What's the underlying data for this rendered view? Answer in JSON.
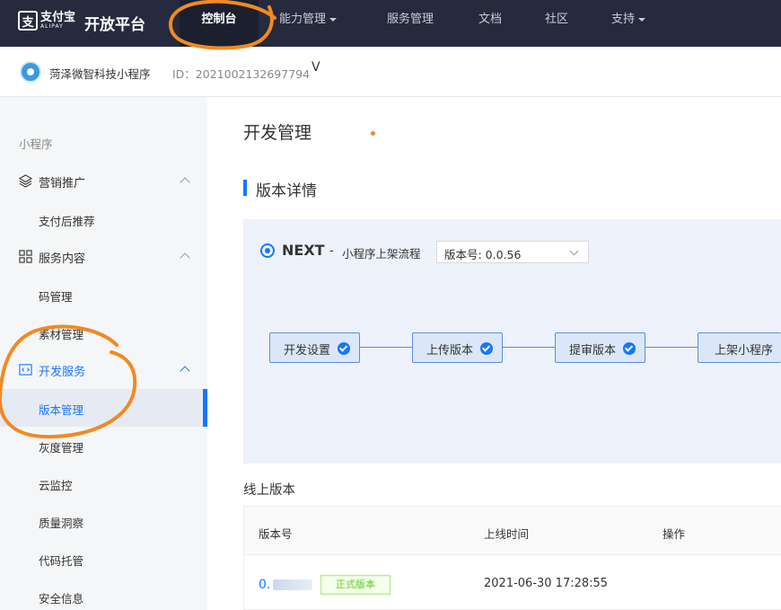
{
  "topnav": {
    "logo_cn": "支付宝",
    "logo_en": "ALIPAY",
    "platform": "开放平台",
    "items": [
      {
        "label": "控制台",
        "active": true,
        "has_caret": false
      },
      {
        "label": "能力管理",
        "active": false,
        "has_caret": true
      },
      {
        "label": "服务管理",
        "active": false,
        "has_caret": false
      },
      {
        "label": "文档",
        "active": false,
        "has_caret": false
      },
      {
        "label": "社区",
        "active": false,
        "has_caret": false
      },
      {
        "label": "支持",
        "active": false,
        "has_caret": true
      }
    ]
  },
  "appbar": {
    "name": "菏泽微智科技小程序",
    "id": "ID：2021002132697794",
    "chevron": "V"
  },
  "sidebar": {
    "title": "小程序",
    "groups": [
      {
        "label": "营销推广",
        "icon": "layers-icon",
        "items": [
          "支付后推荐"
        ]
      },
      {
        "label": "服务内容",
        "icon": "grid-icon",
        "items": [
          "码管理",
          "素材管理"
        ]
      },
      {
        "label": "开发服务",
        "icon": "code-icon",
        "active": true,
        "items": [
          "版本管理",
          "灰度管理",
          "云监控",
          "质量洞察",
          "代码托管",
          "安全信息"
        ]
      }
    ],
    "selected": "版本管理"
  },
  "main": {
    "page_title": "开发管理",
    "section_title": "版本详情",
    "next": {
      "brand": "NEXT",
      "dash": "-",
      "subtitle": "小程序上架流程",
      "version_select": "版本号: 0.0.56"
    },
    "steps": [
      {
        "label": "开发设置",
        "done": true
      },
      {
        "label": "上传版本",
        "done": true
      },
      {
        "label": "提审版本",
        "done": true
      },
      {
        "label": "上架小程序",
        "done": false
      }
    ],
    "online_title": "线上版本",
    "table": {
      "headers": [
        "版本号",
        "上线时间",
        "操作"
      ],
      "rows": [
        {
          "version": "0.",
          "tag": "正式版本",
          "time": "2021-06-30 17:28:55"
        }
      ]
    }
  },
  "colors": {
    "nav_bg": "#262a3d",
    "accent": "#1677ff",
    "annotation": "#f08a24",
    "panel_bg": "#edf2fb"
  }
}
